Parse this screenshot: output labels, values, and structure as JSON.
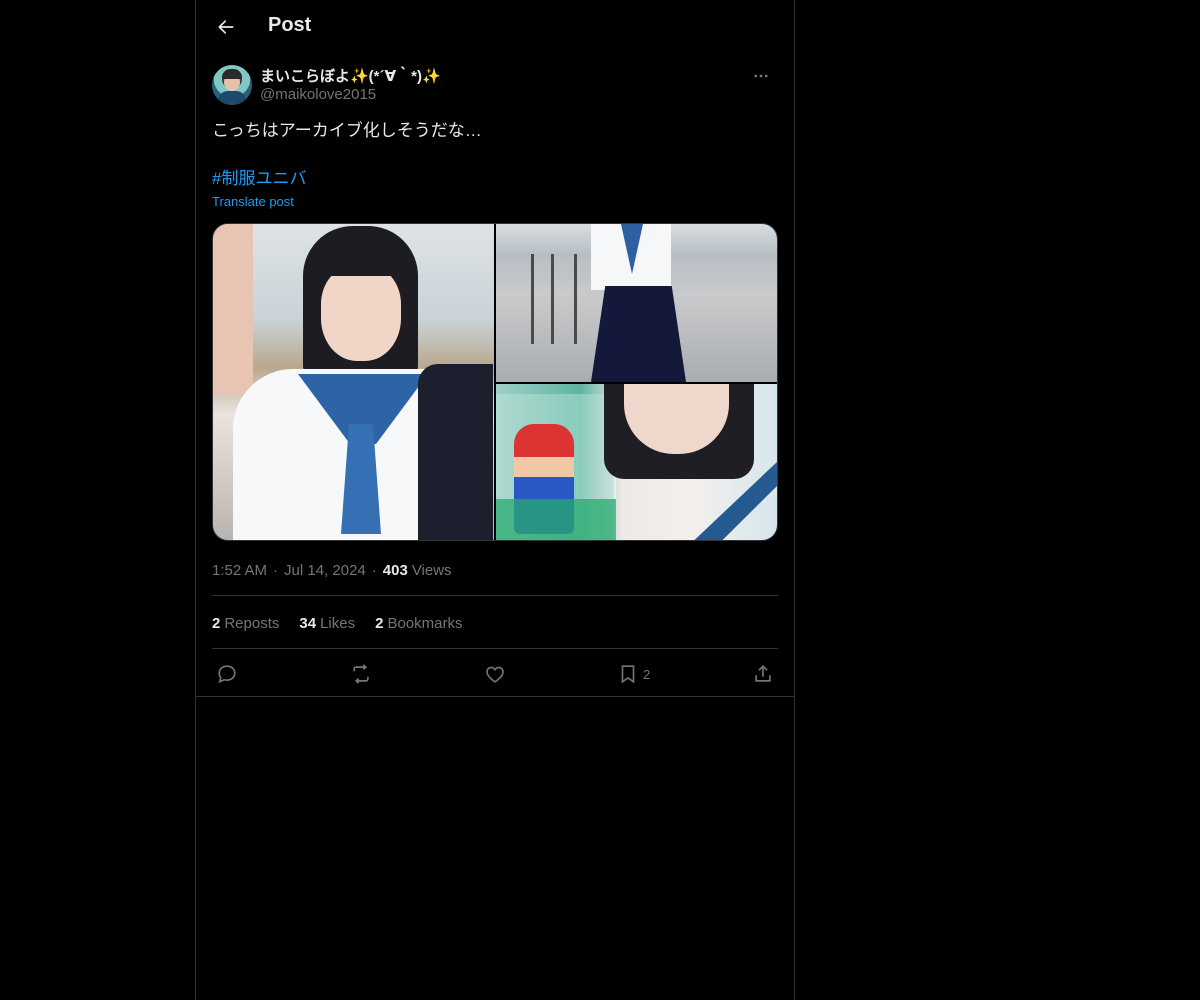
{
  "header": {
    "title": "Post",
    "back_icon": "arrow-left-icon"
  },
  "author": {
    "display_name": "まいこらぼよ✨(*´∀｀*)✨",
    "handle": "@maikolove2015",
    "more_icon": "more-horizontal-icon"
  },
  "post": {
    "text": "こっちはアーカイブ化しそうだな…",
    "hashtag": "#制服ユニバ",
    "translate_label": "Translate post",
    "media_count": 3
  },
  "meta": {
    "time": "1:52 AM",
    "date": "Jul 14, 2024",
    "views_count": "403",
    "views_label": "Views"
  },
  "stats": {
    "reposts_count": "2",
    "reposts_label": "Reposts",
    "likes_count": "34",
    "likes_label": "Likes",
    "bookmarks_count": "2",
    "bookmarks_label": "Bookmarks"
  },
  "actions": {
    "reply_icon": "reply-icon",
    "repost_icon": "repost-icon",
    "like_icon": "heart-icon",
    "bookmark_icon": "bookmark-icon",
    "bookmark_count": "2",
    "share_icon": "share-icon"
  },
  "colors": {
    "background": "#000000",
    "text_primary": "#e7e9ea",
    "text_secondary": "#71767b",
    "accent": "#1d9bf0",
    "border": "#2f3336"
  }
}
